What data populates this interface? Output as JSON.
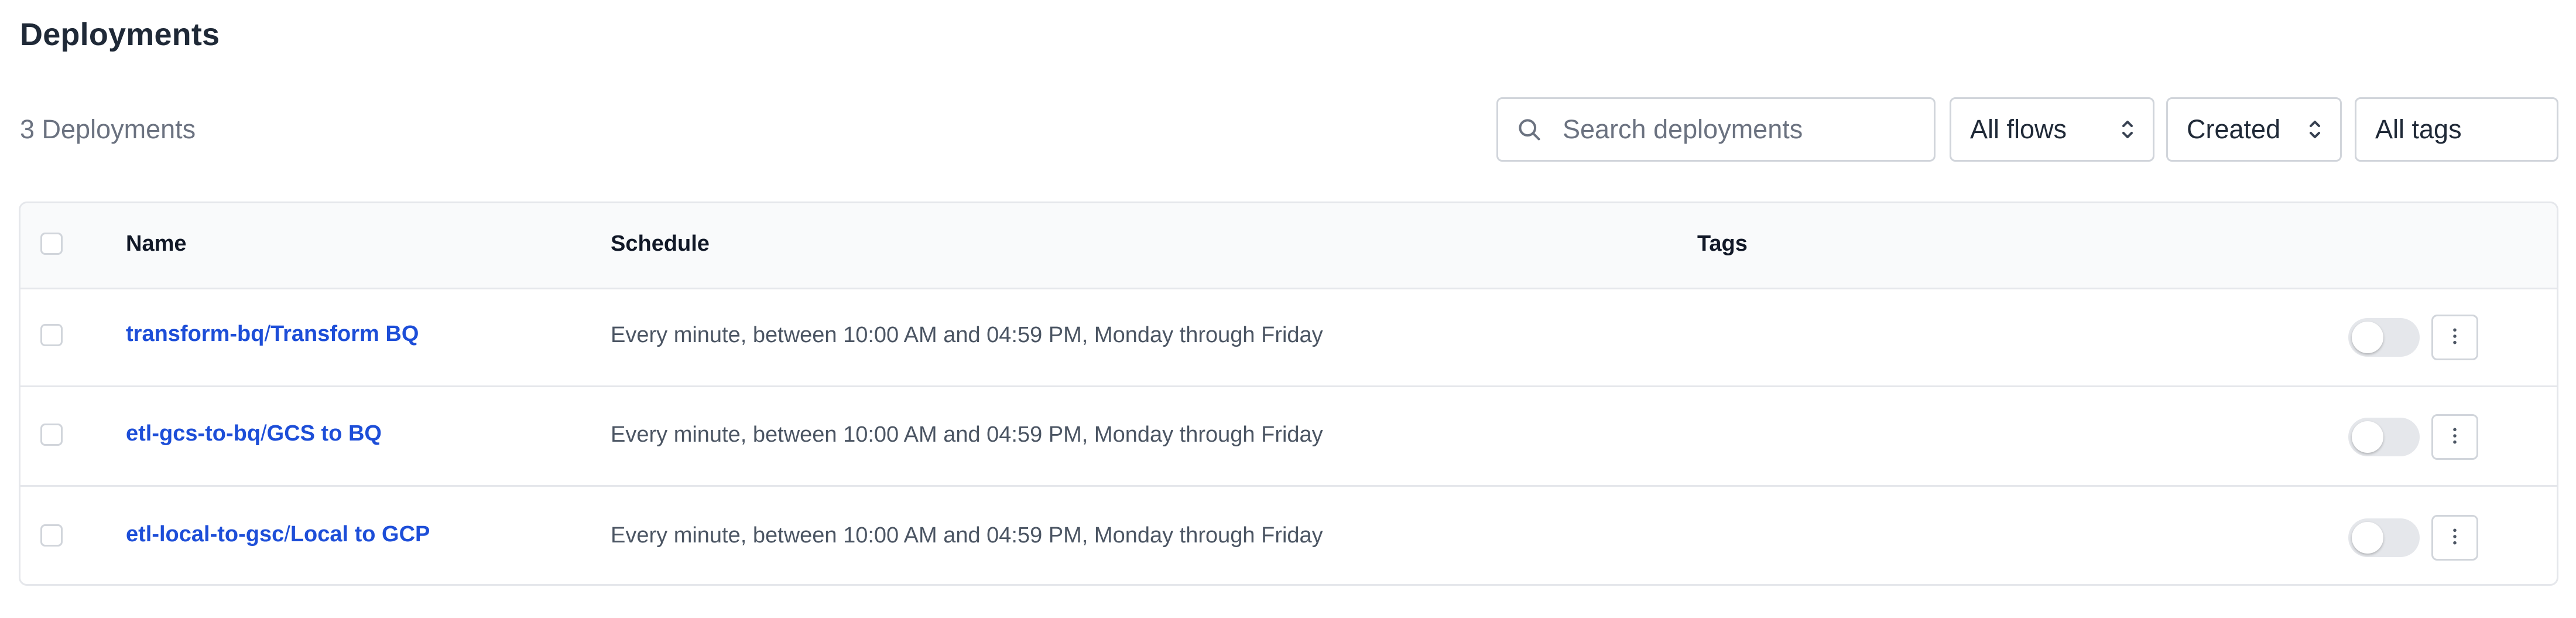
{
  "page": {
    "title": "Deployments",
    "count_text": "3 Deployments"
  },
  "filters": {
    "search_placeholder": "Search deployments",
    "search_value": "",
    "flows_selected": "All flows",
    "sort_selected": "Created",
    "tags_selected": "All tags"
  },
  "table": {
    "columns": [
      "Name",
      "Schedule",
      "Tags"
    ],
    "rows": [
      {
        "flow": "transform-bq",
        "separator": "/",
        "deployment": "Transform BQ",
        "schedule": "Every minute, between 10:00 AM and 04:59 PM, Monday through Friday",
        "active": false
      },
      {
        "flow": "etl-gcs-to-bq",
        "separator": "/",
        "deployment": "GCS to BQ",
        "schedule": "Every minute, between 10:00 AM and 04:59 PM, Monday through Friday",
        "active": false
      },
      {
        "flow": "etl-local-to-gsc",
        "separator": "/",
        "deployment": "Local to GCP",
        "schedule": "Every minute, between 10:00 AM and 04:59 PM, Monday through Friday",
        "active": false
      }
    ]
  },
  "icons": {
    "search": "search-icon",
    "select": "chevron-up-down-icon",
    "row_menu": "kebab-menu-icon"
  },
  "colors": {
    "link": "#1d4ed8",
    "toggle_off": "#e5e7eb",
    "border": "#d1d5db"
  }
}
